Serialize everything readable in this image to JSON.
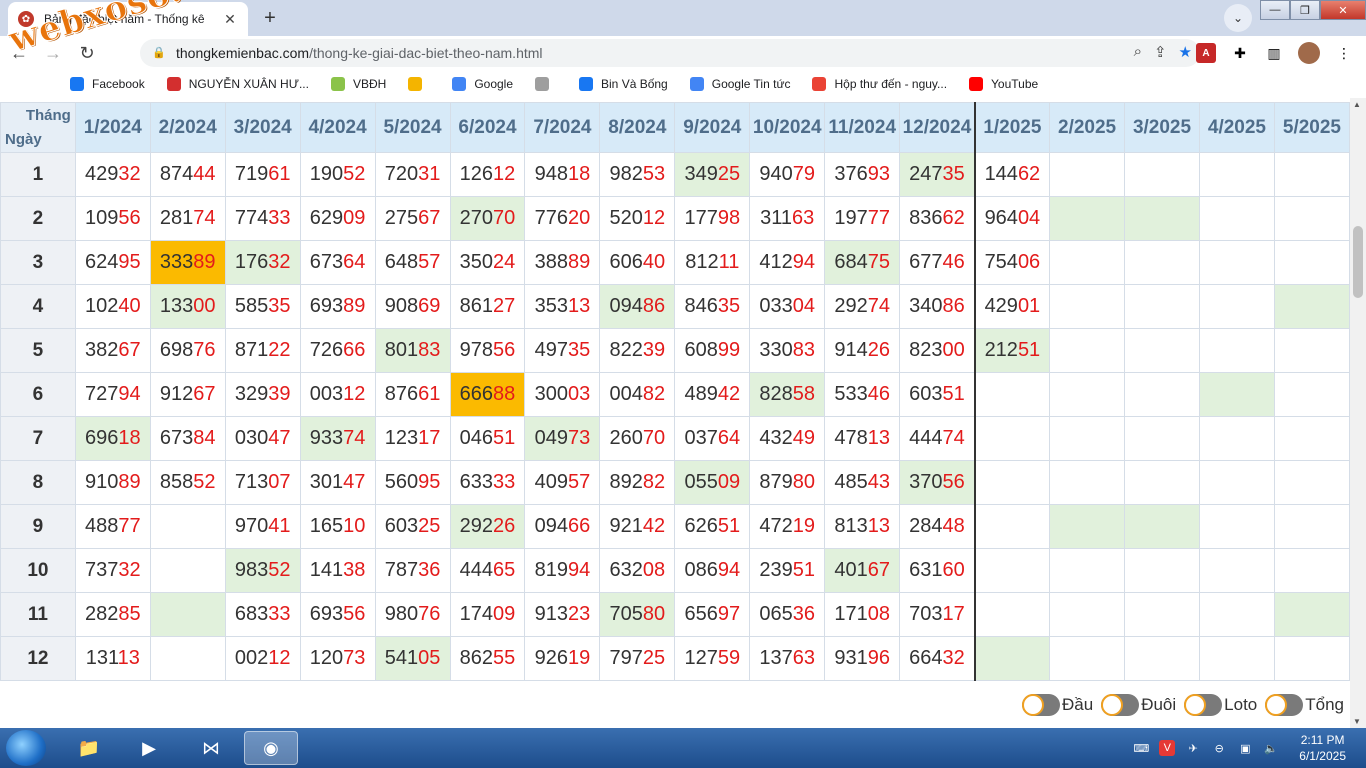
{
  "tab": {
    "title": "Bảng đặc biệt năm - Thống kê",
    "close": "✕",
    "new": "+"
  },
  "window": {
    "minimize": "—",
    "maximize": "❐",
    "close": "✕"
  },
  "omnibox": {
    "host": "thongkemienbac.com",
    "path": "/thong-ke-giai-dac-biet-theo-nam.html"
  },
  "watermark": "webxoso.net",
  "bookmarks": [
    {
      "label": "Facebook",
      "color": "#1877f2"
    },
    {
      "label": "NGUYỄN XUÂN HƯ...",
      "color": "#d32f2f"
    },
    {
      "label": "VBĐH",
      "color": "#8bc34a"
    },
    {
      "label": "",
      "color": "#f4b400"
    },
    {
      "label": "Google",
      "color": "#4285f4"
    },
    {
      "label": "",
      "color": "#9e9e9e"
    },
    {
      "label": "Bin Và Bống",
      "color": "#1877f2"
    },
    {
      "label": "Google Tin tức",
      "color": "#4285f4"
    },
    {
      "label": "Hộp thư đến - nguy...",
      "color": "#ea4335"
    },
    {
      "label": "YouTube",
      "color": "#ff0000"
    }
  ],
  "table": {
    "corner_top": "Tháng",
    "corner_bottom": "Ngày",
    "months": [
      "1/2024",
      "2/2024",
      "3/2024",
      "4/2024",
      "5/2024",
      "6/2024",
      "7/2024",
      "8/2024",
      "9/2024",
      "10/2024",
      "11/2024",
      "12/2024",
      "1/2025",
      "2/2025",
      "3/2025",
      "4/2025",
      "5/2025"
    ],
    "rows": [
      {
        "day": "1",
        "cells": [
          "42932",
          "87444",
          "71961",
          "19052",
          "72031",
          "12612",
          "94818",
          "98253",
          "34925",
          "94079",
          "37693",
          "24735",
          "14462",
          "",
          "",
          "",
          ""
        ]
      },
      {
        "day": "2",
        "cells": [
          "10956",
          "28174",
          "77433",
          "62909",
          "27567",
          "27070",
          "77620",
          "52012",
          "17798",
          "31163",
          "19777",
          "83662",
          "96404",
          "",
          "",
          "",
          ""
        ]
      },
      {
        "day": "3",
        "cells": [
          "62495",
          "33389",
          "17632",
          "67364",
          "64857",
          "35024",
          "38889",
          "60640",
          "81211",
          "41294",
          "68475",
          "67746",
          "75406",
          "",
          "",
          "",
          ""
        ]
      },
      {
        "day": "4",
        "cells": [
          "10240",
          "13300",
          "58535",
          "69389",
          "90869",
          "86127",
          "35313",
          "09486",
          "84635",
          "03304",
          "29274",
          "34086",
          "42901",
          "",
          "",
          "",
          ""
        ]
      },
      {
        "day": "5",
        "cells": [
          "38267",
          "69876",
          "87122",
          "72666",
          "80183",
          "97856",
          "49735",
          "82239",
          "60899",
          "33083",
          "91426",
          "82300",
          "21251",
          "",
          "",
          "",
          ""
        ]
      },
      {
        "day": "6",
        "cells": [
          "72794",
          "91267",
          "32939",
          "00312",
          "87661",
          "66688",
          "30003",
          "00482",
          "48942",
          "82858",
          "53346",
          "60351",
          "",
          "",
          "",
          "",
          ""
        ]
      },
      {
        "day": "7",
        "cells": [
          "69618",
          "67384",
          "03047",
          "93374",
          "12317",
          "04651",
          "04973",
          "26070",
          "03764",
          "43249",
          "47813",
          "44474",
          "",
          "",
          "",
          "",
          ""
        ]
      },
      {
        "day": "8",
        "cells": [
          "91089",
          "85852",
          "71307",
          "30147",
          "56095",
          "63333",
          "40957",
          "89282",
          "05509",
          "87980",
          "48543",
          "37056",
          "",
          "",
          "",
          "",
          ""
        ]
      },
      {
        "day": "9",
        "cells": [
          "48877",
          "",
          "97041",
          "16510",
          "60325",
          "29226",
          "09466",
          "92142",
          "62651",
          "47219",
          "81313",
          "28448",
          "",
          "",
          "",
          "",
          ""
        ]
      },
      {
        "day": "10",
        "cells": [
          "73732",
          "",
          "98352",
          "14138",
          "78736",
          "44465",
          "81994",
          "63208",
          "08694",
          "23951",
          "40167",
          "63160",
          "",
          "",
          "",
          "",
          ""
        ]
      },
      {
        "day": "11",
        "cells": [
          "28285",
          "",
          "68333",
          "69356",
          "98076",
          "17409",
          "91323",
          "70580",
          "65697",
          "06536",
          "17108",
          "70317",
          "",
          "",
          "",
          "",
          ""
        ]
      },
      {
        "day": "12",
        "cells": [
          "13113",
          "",
          "00212",
          "12073",
          "54105",
          "86255",
          "92619",
          "79725",
          "12759",
          "13763",
          "93196",
          "66432",
          "",
          "",
          "",
          "",
          ""
        ]
      }
    ],
    "highlights_green": [
      "1-8",
      "1-11",
      "2-5",
      "2-13",
      "2-14",
      "3-2",
      "3-10",
      "4-1",
      "4-7",
      "4-16",
      "5-4",
      "5-12",
      "6-9",
      "6-15",
      "7-0",
      "7-3",
      "7-6",
      "8-8",
      "8-11",
      "9-5",
      "9-13",
      "9-14",
      "10-2",
      "10-10",
      "11-1",
      "11-7",
      "11-16",
      "12-4",
      "12-12"
    ],
    "highlights_orange": [
      "3-1",
      "6-5"
    ]
  },
  "toggles": [
    {
      "label": "Đầu"
    },
    {
      "label": "Đuôi"
    },
    {
      "label": "Loto"
    },
    {
      "label": "Tổng"
    }
  ],
  "taskbar": {
    "time": "2:11 PM",
    "date": "6/1/2025"
  }
}
